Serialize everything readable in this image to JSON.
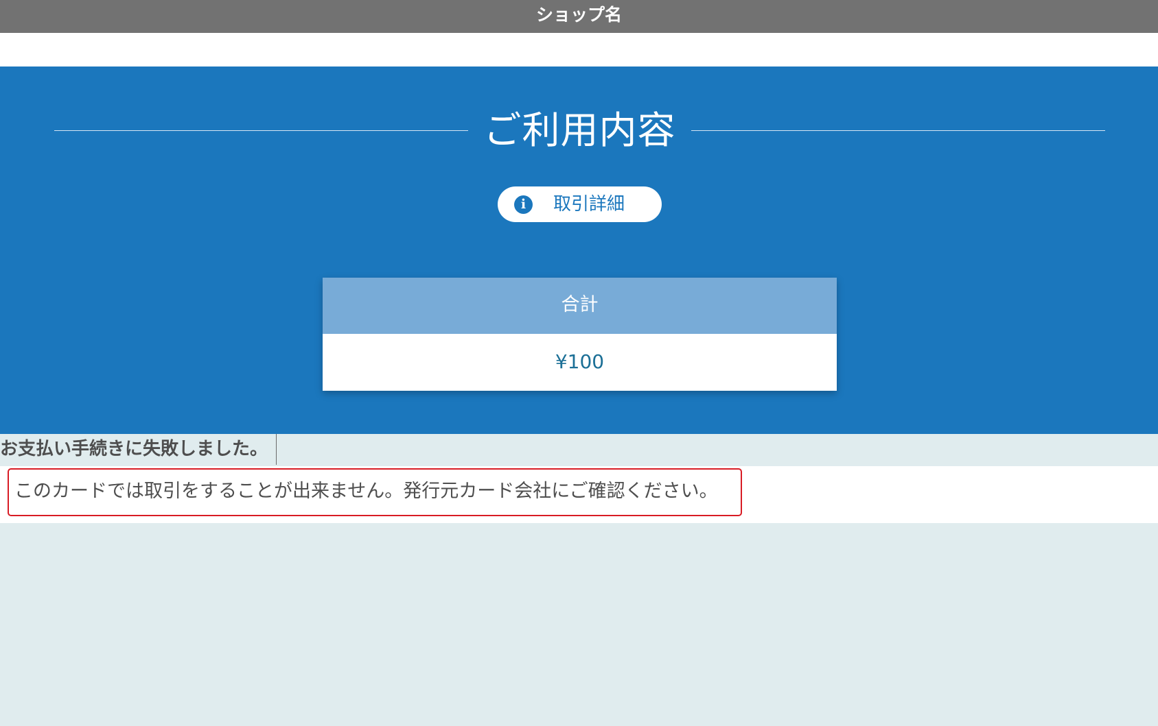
{
  "header": {
    "shop_name": "ショップ名"
  },
  "usage": {
    "title": "ご利用内容",
    "details_button": {
      "icon": "info-icon",
      "icon_glyph": "i",
      "label": "取引詳細"
    },
    "total": {
      "label": "合計",
      "amount": "¥100"
    }
  },
  "error": {
    "heading": "お支払い手続きに失敗しました。",
    "message": "このカードでは取引をすることが出来ません。発行元カード会社にご確認ください。"
  },
  "colors": {
    "header_bg": "#727272",
    "hero_bg": "#1b77bd",
    "card_head_bg": "#78abd7",
    "page_bg": "#e0ecee",
    "error_border": "#d81b24"
  }
}
